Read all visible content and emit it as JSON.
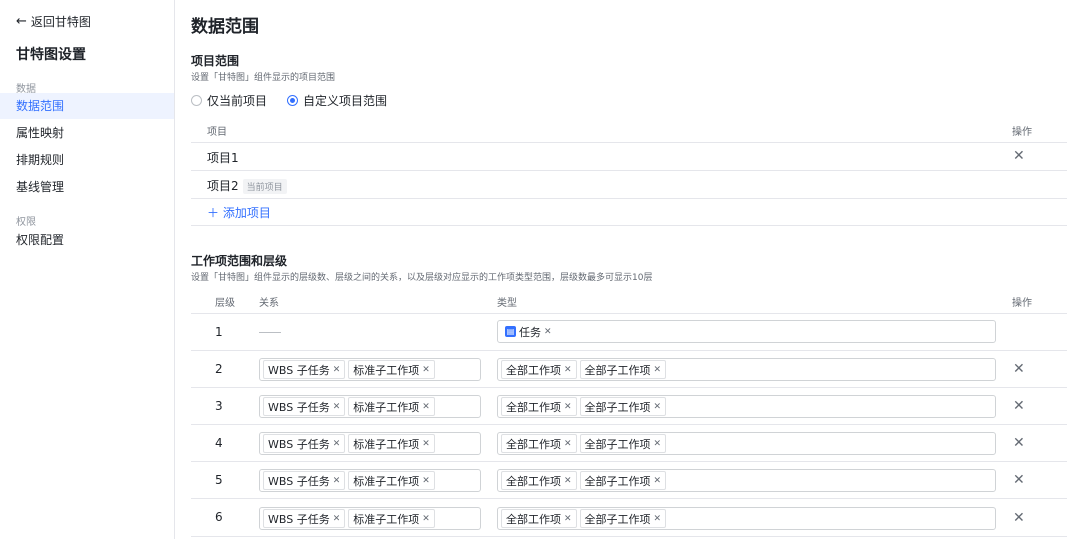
{
  "sidebar": {
    "back_label": "返回甘特图",
    "title": "甘特图设置",
    "groups": [
      {
        "label": "数据",
        "items": [
          "数据范围",
          "属性映射",
          "排期规则",
          "基线管理"
        ]
      },
      {
        "label": "权限",
        "items": [
          "权限配置"
        ]
      }
    ],
    "active_item": "数据范围"
  },
  "main": {
    "title": "数据范围",
    "project_scope": {
      "title": "项目范围",
      "desc": "设置「甘特图」组件显示的项目范围",
      "radio_current": "仅当前项目",
      "radio_custom": "自定义项目范围",
      "selected": "自定义项目范围",
      "col_project": "项目",
      "col_action": "操作",
      "rows": [
        {
          "name": "项目1",
          "tag": ""
        },
        {
          "name": "项目2",
          "tag": "当前项目"
        }
      ],
      "add_label": "添加项目"
    },
    "level_scope": {
      "title": "工作项范围和层级",
      "desc": "设置「甘特图」组件显示的层级数、层级之间的关系，以及层级对应显示的工作项类型范围，层级数最多可显示10层",
      "col_level": "层级",
      "col_relation": "关系",
      "col_type": "类型",
      "col_action": "操作",
      "rows": [
        {
          "level": "1",
          "relations": [],
          "types": [
            "任务"
          ]
        },
        {
          "level": "2",
          "relations": [
            "WBS 子任务",
            "标准子工作项"
          ],
          "types": [
            "全部工作项",
            "全部子工作项"
          ]
        },
        {
          "level": "3",
          "relations": [
            "WBS 子任务",
            "标准子工作项"
          ],
          "types": [
            "全部工作项",
            "全部子工作项"
          ]
        },
        {
          "level": "4",
          "relations": [
            "WBS 子任务",
            "标准子工作项"
          ],
          "types": [
            "全部工作项",
            "全部子工作项"
          ]
        },
        {
          "level": "5",
          "relations": [
            "WBS 子任务",
            "标准子工作项"
          ],
          "types": [
            "全部工作项",
            "全部子工作项"
          ]
        },
        {
          "level": "6",
          "relations": [
            "WBS 子任务",
            "标准子工作项"
          ],
          "types": [
            "全部工作项",
            "全部子工作项"
          ]
        }
      ]
    },
    "icons": {
      "back": "arrow-left-icon",
      "close": "close-icon",
      "add": "plus-icon",
      "remove_tag": "tag-close-icon",
      "task": "task-type-icon"
    },
    "accent_color": "#3370ff"
  }
}
